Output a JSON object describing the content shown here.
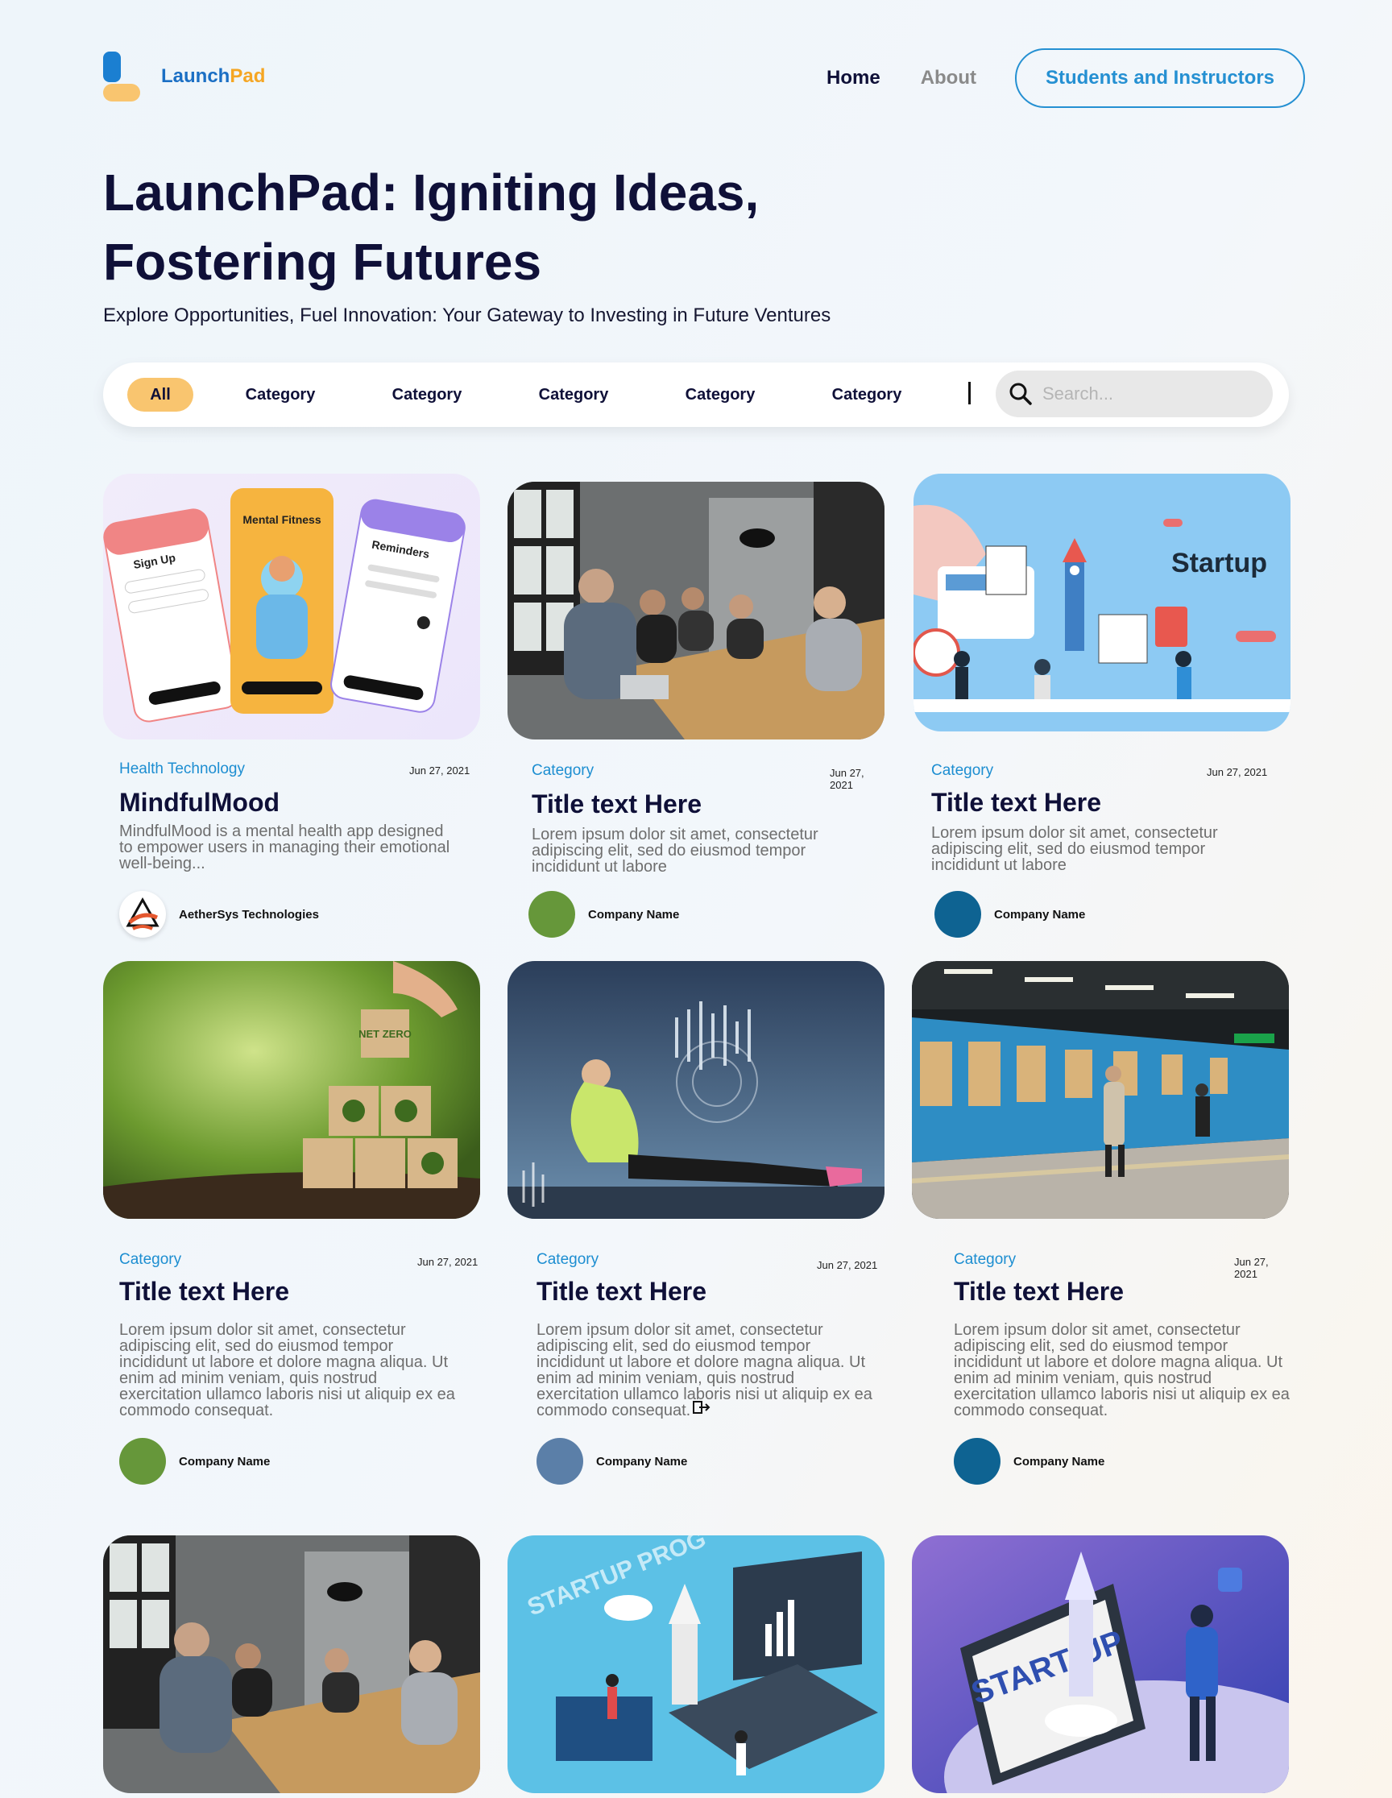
{
  "brand": {
    "name_part1": "Launch",
    "name_part2": "Pad"
  },
  "nav": {
    "home": "Home",
    "about": "About",
    "cta": "Students and Instructors"
  },
  "hero": {
    "title": "LaunchPad: Igniting Ideas, Fostering Futures",
    "subtitle": "Explore Opportunities, Fuel Innovation: Your Gateway to Investing in Future Ventures"
  },
  "filters": {
    "all": "All",
    "categories": [
      "Category",
      "Category",
      "Category",
      "Category",
      "Category"
    ],
    "search_placeholder": "Search..."
  },
  "colors": {
    "accent_blue": "#2590d2",
    "accent_yellow": "#f9c56f",
    "heading": "#0f1038"
  },
  "cards": [
    {
      "category": "Health Technology",
      "date": "Jun 27, 2021",
      "title": "MindfulMood",
      "description": "MindfulMood is a mental health app designed to empower users in managing their emotional well‑being...",
      "company": "AetherSys Technologies"
    },
    {
      "category": "Category",
      "date": "Jun 27, 2021",
      "title": "Title text Here",
      "description": "Lorem ipsum dolor sit amet, consectetur adipiscing elit, sed do eiusmod tempor incididunt ut labore",
      "company": "Company Name"
    },
    {
      "category": "Category",
      "date": "Jun 27, 2021",
      "title": "Title text Here",
      "description": "Lorem ipsum dolor sit amet, consectetur adipiscing elit, sed do eiusmod tempor incididunt ut labore",
      "company": "Company Name"
    },
    {
      "category": "Category",
      "date": "Jun 27, 2021",
      "title": "Title text Here",
      "description": "Lorem ipsum dolor sit amet, consectetur adipiscing elit, sed do eiusmod tempor incididunt ut labore et dolore magna aliqua. Ut enim ad minim veniam, quis nostrud exercitation ullamco laboris nisi ut aliquip ex ea commodo consequat.",
      "company": "Company Name"
    },
    {
      "category": "Category",
      "date": "Jun 27, 2021",
      "title": "Title text Here",
      "description": "Lorem ipsum dolor sit amet, consectetur adipiscing elit, sed do eiusmod tempor incididunt ut labore et dolore magna aliqua. Ut enim ad minim veniam, quis nostrud exercitation ullamco laboris nisi ut aliquip ex ea commodo consequat.",
      "company": "Company Name"
    },
    {
      "category": "Category",
      "date": "Jun 27, 2021",
      "title": "Title text Here",
      "description": "Lorem ipsum dolor sit amet, consectetur adipiscing elit, sed do eiusmod tempor incididunt ut labore et dolore magna aliqua. Ut enim ad minim veniam, quis nostrud exercitation ullamco laboris nisi ut aliquip ex ea commodo consequat.",
      "company": "Company Name"
    }
  ],
  "thumb_text": {
    "app_signup": "Sign Up",
    "app_fitness": "Mental Fitness",
    "app_reminders": "Reminders",
    "startup_title": "Startup",
    "netzero": "NET ZERO",
    "startup_prog": "STARTUP PROG",
    "start_up": "START UP"
  }
}
